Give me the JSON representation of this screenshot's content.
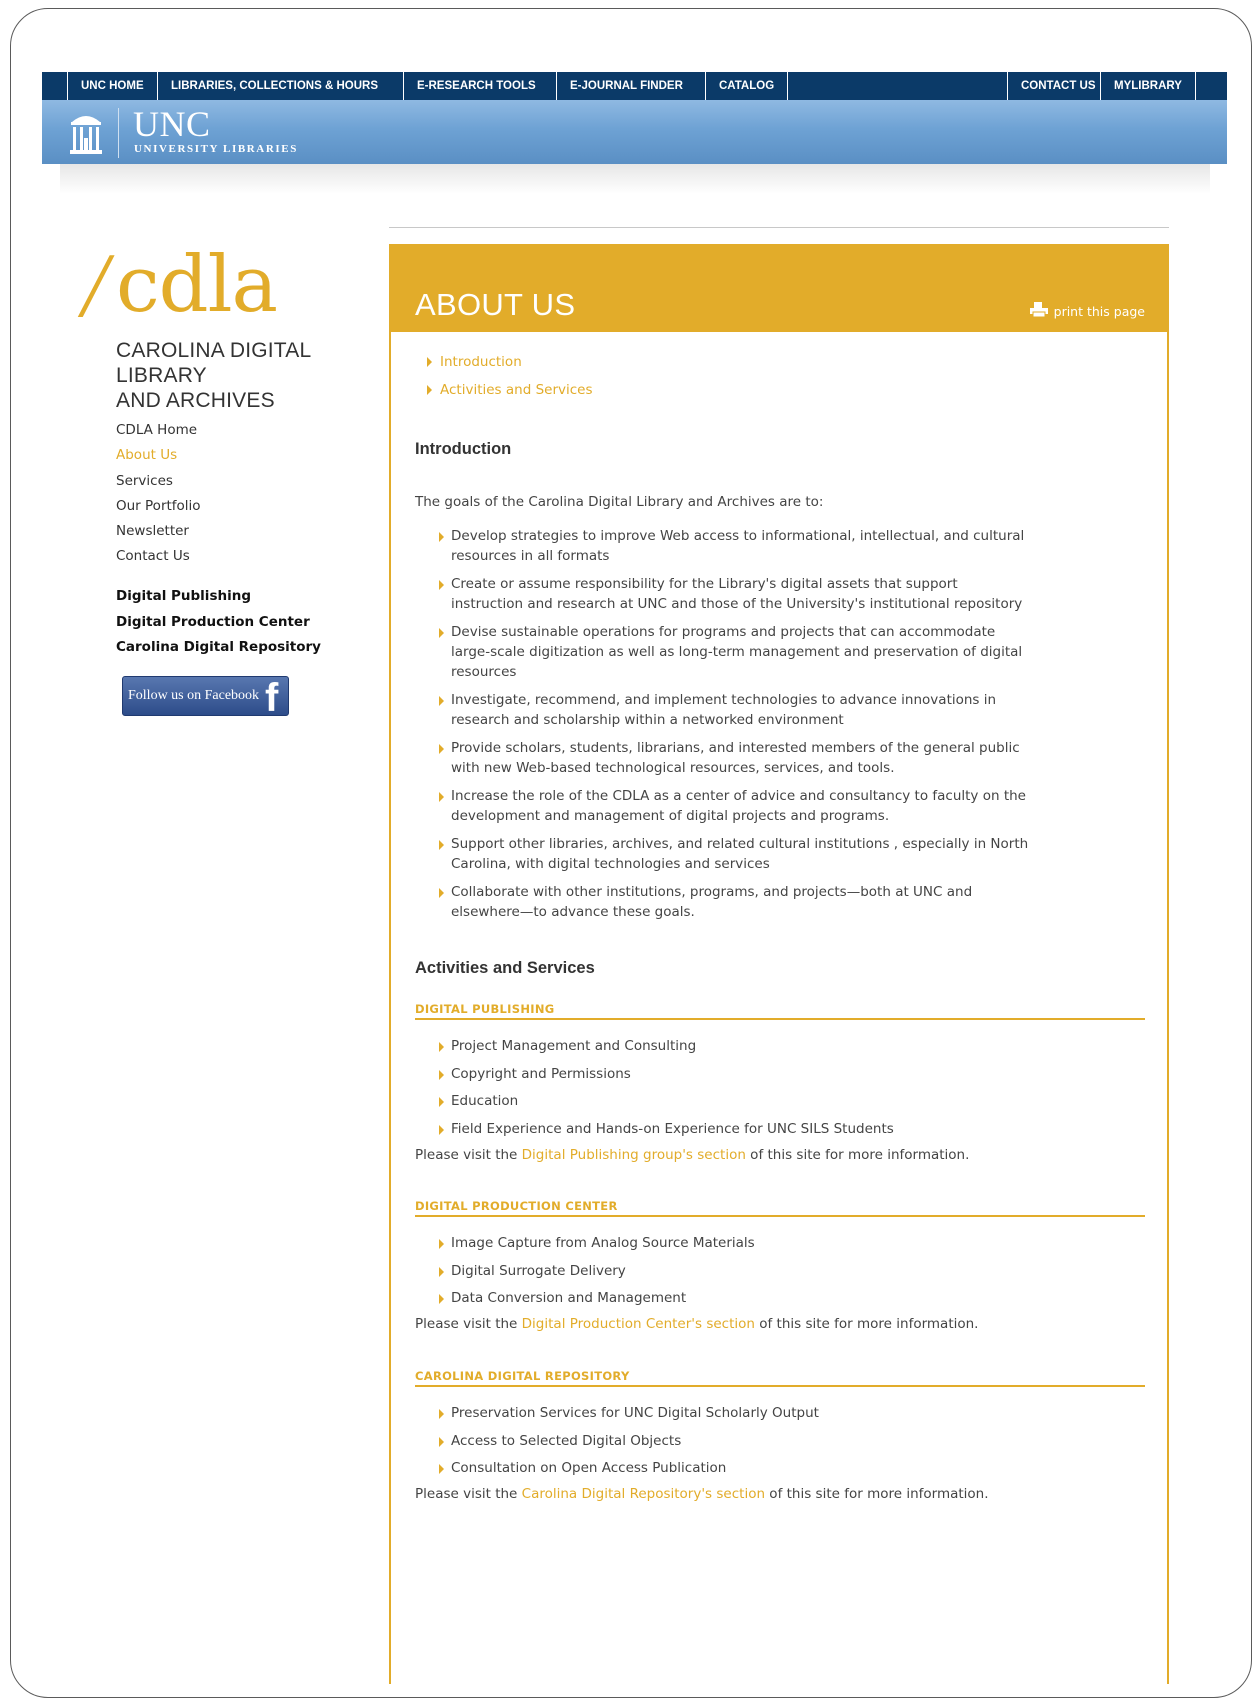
{
  "topnav": {
    "unc_home": "UNC HOME",
    "libraries": "LIBRARIES, COLLECTIONS & HOURS",
    "eresearch": "E-RESEARCH TOOLS",
    "ejournal": "E-JOURNAL FINDER",
    "catalog": "CATALOG",
    "contact": "CONTACT US",
    "mylibrary": "MYLIBRARY"
  },
  "banner": {
    "title": "UNC",
    "subtitle": "UNIVERSITY LIBRARIES"
  },
  "logo": {
    "slash": "/",
    "word": "cdla",
    "title_line1": "CAROLINA DIGITAL LIBRARY",
    "title_line2": "AND ARCHIVES"
  },
  "leftnav": {
    "items": [
      "CDLA Home",
      "About Us",
      "Services",
      "Our Portfolio",
      "Newsletter",
      "Contact Us"
    ],
    "active": "About Us",
    "groups": [
      "Digital Publishing",
      "Digital Production Center",
      "Carolina Digital Repository"
    ]
  },
  "facebook": {
    "label": "Follow us on Facebook",
    "glyph": "f"
  },
  "page": {
    "title": "ABOUT US",
    "print": "print this page"
  },
  "toc": [
    "Introduction",
    "Activities and Services"
  ],
  "intro": {
    "heading": "Introduction",
    "lead": "The goals of the Carolina Digital Library and Archives are to:",
    "goals": [
      "Develop strategies to improve Web access to informational, intellectual, and cultural resources in all formats",
      "Create or assume responsibility for the Library's digital assets that support instruction and research at UNC and those of the University's institutional repository",
      "Devise sustainable operations for programs and projects that can accommodate large-scale digitization as well as long-term management and preservation of digital resources",
      "Investigate, recommend, and implement technologies to advance innovations in research and scholarship within a networked environment",
      "Provide scholars, students, librarians, and interested members of the general public with new Web-based technological resources, services, and tools.",
      "Increase the role of the CDLA as a center of advice and consultancy to faculty on the development and management of digital projects and programs.",
      "Support other libraries, archives, and related cultural institutions , especially in North Carolina, with digital technologies and services",
      "Collaborate with other institutions, programs, and projects—both at UNC and elsewhere—to advance these goals."
    ]
  },
  "activities": {
    "heading": "Activities and Services",
    "publishing": {
      "title": "DIGITAL PUBLISHING",
      "items": [
        "Project Management and Consulting",
        "Copyright and Permissions",
        "Education",
        "Field Experience and Hands-on Experience for UNC SILS Students"
      ],
      "pre": "Please visit the ",
      "link": "Digital Publishing group's section",
      "post": " of this site for more information."
    },
    "production": {
      "title": "DIGITAL PRODUCTION CENTER",
      "items": [
        "Image Capture from Analog Source Materials",
        "Digital Surrogate Delivery",
        "Data Conversion and Management"
      ],
      "pre": "Please visit the ",
      "link": "Digital Production Center's section",
      "post": " of this site for more information."
    },
    "repository": {
      "title": "CAROLINA DIGITAL REPOSITORY",
      "items": [
        "Preservation Services for UNC Digital Scholarly Output",
        "Access to Selected Digital Objects",
        "Consultation on Open Access Publication"
      ],
      "pre": "Please visit the ",
      "link": "Carolina Digital Repository's section",
      "post": " of this site for more information."
    }
  },
  "colors": {
    "accent": "#e2ac2a",
    "navy": "#0b3a68",
    "banner_blue": "#6ea2d4",
    "text": "#444444"
  }
}
